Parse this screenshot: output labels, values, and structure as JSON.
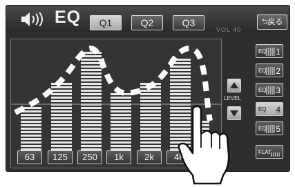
{
  "header": {
    "title": "EQ",
    "presets": [
      {
        "label": "Q1",
        "active": true
      },
      {
        "label": "Q2",
        "active": false
      },
      {
        "label": "Q3",
        "active": false
      }
    ],
    "volume": "VOL 40",
    "back_label": "⮌戻る"
  },
  "equalizer": {
    "bands": [
      "63",
      "125",
      "250",
      "1k",
      "2k",
      "4k"
    ],
    "level_label": "LEVEL"
  },
  "presets_side": [
    {
      "label": "EQ",
      "number": "1",
      "active": false
    },
    {
      "label": "EQ",
      "number": "2",
      "active": false
    },
    {
      "label": "EQ",
      "number": "3",
      "active": false
    },
    {
      "label": "EQ",
      "number": "4",
      "active": true
    },
    {
      "label": "EQ",
      "number": "5",
      "active": false
    }
  ],
  "flat_label": "FLAT",
  "colors": {
    "bg": "#2e2e2e",
    "bar": "#e8e8e8",
    "accent_active": "#cfcfcf",
    "curve": "#ffffff"
  }
}
